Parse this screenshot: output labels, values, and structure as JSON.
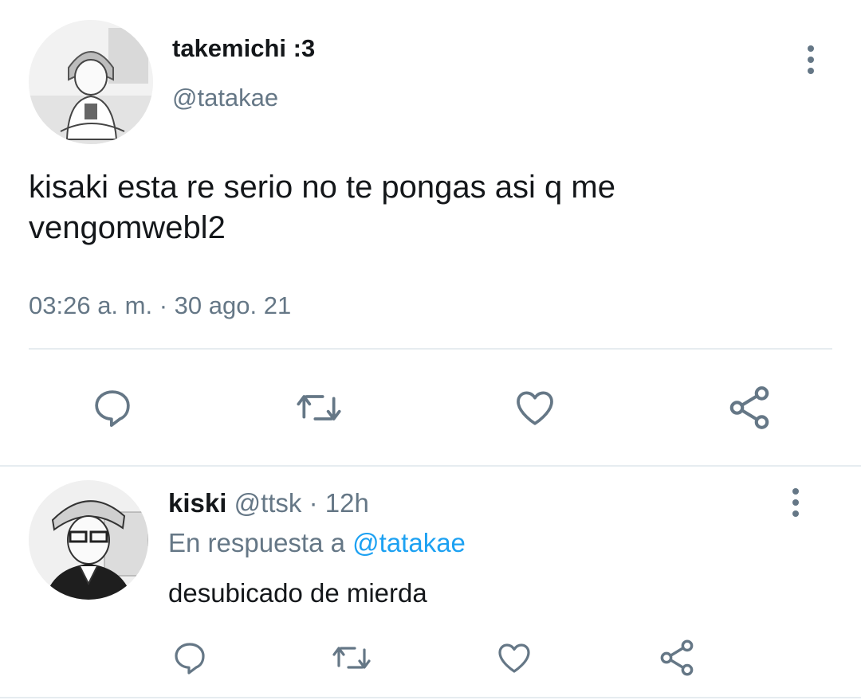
{
  "main_tweet": {
    "display_name": "takemichi :3",
    "handle": "@tatakae",
    "text_line1": "kisaki esta re serio no te pongas asi q me",
    "text_line2": "vengomwebl2",
    "time": "03:26 a. m.",
    "separator": "·",
    "date": "30 ago. 21",
    "actions": [
      "reply-icon",
      "retweet-icon",
      "like-icon",
      "share-icon"
    ]
  },
  "reply_tweet": {
    "display_name": "kiski",
    "handle": "@ttsk",
    "separator": "·",
    "age": "12h",
    "reply_prefix": "En respuesta a",
    "reply_to": "@tatakae",
    "text": "desubicado de mierda",
    "actions": [
      "reply-icon",
      "retweet-icon",
      "like-icon",
      "share-icon"
    ]
  },
  "colors": {
    "text": "#14171a",
    "muted": "#657786",
    "link": "#1da1f2",
    "divider": "#e6ecf0"
  }
}
